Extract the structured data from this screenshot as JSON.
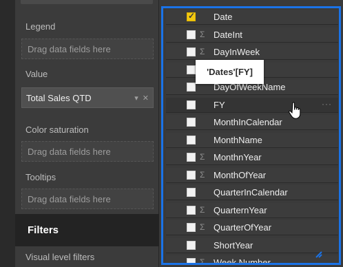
{
  "wells": {
    "legend_label": "Legend",
    "legend_placeholder": "Drag data fields here",
    "value_label": "Value",
    "value_field": "Total Sales QTD",
    "color_saturation_label": "Color saturation",
    "color_saturation_placeholder": "Drag data fields here",
    "tooltips_label": "Tooltips",
    "tooltips_placeholder": "Drag data fields here"
  },
  "filters": {
    "title": "Filters",
    "visual_level_label": "Visual level filters"
  },
  "fields": [
    {
      "name": "Date",
      "checked": true,
      "sigma": false
    },
    {
      "name": "DateInt",
      "checked": false,
      "sigma": true
    },
    {
      "name": "DayInWeek",
      "checked": false,
      "sigma": true
    },
    {
      "name": "DayOfWeek",
      "checked": false,
      "sigma": false
    },
    {
      "name": "DayOfWeekName",
      "checked": false,
      "sigma": false
    },
    {
      "name": "FY",
      "checked": false,
      "sigma": false
    },
    {
      "name": "MonthInCalendar",
      "checked": false,
      "sigma": false
    },
    {
      "name": "MonthName",
      "checked": false,
      "sigma": false
    },
    {
      "name": "MonthnYear",
      "checked": false,
      "sigma": true
    },
    {
      "name": "MonthOfYear",
      "checked": false,
      "sigma": true
    },
    {
      "name": "QuarterInCalendar",
      "checked": false,
      "sigma": false
    },
    {
      "name": "QuarternYear",
      "checked": false,
      "sigma": true
    },
    {
      "name": "QuarterOfYear",
      "checked": false,
      "sigma": true
    },
    {
      "name": "ShortYear",
      "checked": false,
      "sigma": false
    },
    {
      "name": "Week Number",
      "checked": false,
      "sigma": true
    }
  ],
  "tooltip": {
    "text": "'Dates'[FY]"
  },
  "colors": {
    "accent_border": "#1a73e8",
    "checkbox_checked": "#f2c811",
    "pane_bg": "#3b3b3b"
  }
}
